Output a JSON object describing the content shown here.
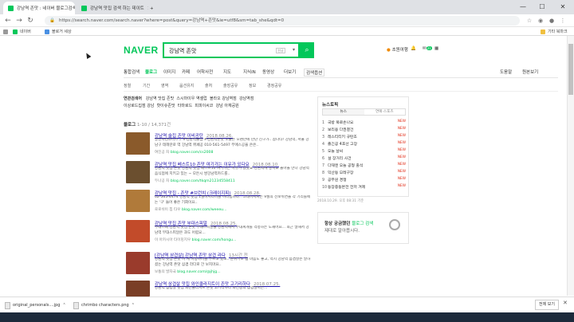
{
  "browser": {
    "tabs": [
      {
        "label": "강남역 존맛 : 네이버 블로그검색",
        "active": true
      },
      {
        "label": "강남역 맛집 검색 하는 데이트",
        "active": false
      }
    ],
    "new_tab": "+",
    "window_buttons": [
      "—",
      "☐",
      "✕"
    ],
    "url": "https://search.naver.com/search.naver?where=post&query=강남역+존맛&ie=utf8&sm=tab_she&qdt=0",
    "bookmarks": [
      "네이버",
      "블로거 세상"
    ],
    "bookmarks_right": "기타 북마크"
  },
  "naver": {
    "logo": "NAVER",
    "query": "강남역 존맛",
    "kbd": "한글",
    "header_right": [
      "초원여행",
      "메일",
      "알림"
    ],
    "mail_count": "31"
  },
  "category_tabs": [
    "통합검색",
    "블로그",
    "이미지",
    "카페",
    "어학사전",
    "지도",
    "지식iN",
    "동영상",
    "더보기",
    "검색옵션"
  ],
  "category_right": [
    "도움말",
    "원본보기"
  ],
  "filter_options": [
    "정렬",
    "기간",
    "영역",
    "옵션유지",
    "출처",
    "출장공유",
    "정보",
    "경정공유"
  ],
  "related": {
    "label": "연관검색어",
    "row1": [
      "강남역 맛집 존맛",
      "스시마이우 역셀럽",
      "볼라오 강남역점",
      "강남역점"
    ],
    "row2": [
      "이상로드집점 강남",
      "핫이슈존맛",
      "타마로드",
      "피피이씨코",
      "강남 아재공원"
    ]
  },
  "blog": {
    "label": "블로그",
    "count": "1-10 / 14,371건"
  },
  "results": [
    {
      "title": "강남역 술집 존맛 이비공탄",
      "date": "2018.08.26.",
      "desc": "알찬하겐조니스 ♪ #경남역술집 #경남역존맛 오늘은 오랜만에 만난 친구가.. 참나타! 강남역, 서울 강남구 테헤란로 역 강남역 뷔페공 010-561-5497 부에스공을 은은..",
      "blogger": "여진공 자",
      "source": "blog.naver.com/cs2008",
      "color": "#8a5a2b"
    },
    {
      "title": "강남역 맛집 베스트10 존맛 여기가는 이유가 있다요",
      "date": "2018.08.10.",
      "desc": "강남역 맛집 존맛 강남역 맛집 베스트10 여기가는 이유가 있었요 강남역에 중학교 돌아올 만나 강남역 음식점에 지키고 있는 ~ 모든시 쌍강남역카드를..",
      "blogger": "두나공 자",
      "source": "blog.naver.com/tkqm21234558411",
      "color": "#6b4f2f"
    },
    {
      "title": "강남역 맛집 - 존맛 #브런치 (크레이지피)",
      "date": "2018.08.28.",
      "desc": "02-565-4474 강남역 맛집 1월이저다나를 이다입니다.. 크레이지피는 9월의 선보쉬면을 각 기리를에는 '구' 들어 좋은 기회이요..",
      "blogger": "로로쉬이 칩 타우",
      "source": "blog.naver.com/weeeu...",
      "color": "#b07a3a"
    },
    {
      "title": "강남역 맛집 존맛 부대스피알",
      "date": "2018.08.25.",
      "desc": "부대스페 강남역 맛집 존맛 부대스피알을 강남역에서 부대찌개를 걱정하는 도재어요... 최근 많해서 강남역 부대스피알은 과도 어렵요...",
      "blogger": "이 아카시아 타이밍지우",
      "source": "blog.naver.com/hongu...",
      "color": "#c24b2a"
    },
    {
      "title": "[강남역 삼겹살] 강남역 존맛 삼겹 라다",
      "date": "13시간 전",
      "desc": "강남역 맛집 존맛 이 게 이동하나를 부르고 있고.. 분위기도 넘 마음도 좋고, 역시 강남역 삼겹살은 말하셨는 강남역 존맛 삼겹 라다로 간 보지마요..",
      "blogger": "보통의 발자국",
      "source": "blog.naver.com/@jhjg...",
      "color": "#9a3b2c"
    },
    {
      "title": "강남역 삼겹살 맛집 와인클라지트이 존맛 고기리하다",
      "date": "2018.07.25.",
      "desc": "강남역 삼겹살 맛집 와인클라지트 존맛 고기리하다 와인동의 삼겹살이는...",
      "blogger": "",
      "source": "",
      "color": "#7a3e26"
    }
  ],
  "news": {
    "heading": "뉴스토픽",
    "tabs": [
      "뉴스",
      "연예·스포츠"
    ],
    "items": [
      {
        "num": "1",
        "text": "국방 북로손나요",
        "new": true
      },
      {
        "num": "2",
        "text": "보리용 다권결건",
        "new": true
      },
      {
        "num": "3",
        "text": "레스티티키 규탄조",
        "new": true
      },
      {
        "num": "4",
        "text": "졸긴공 4호선 고장",
        "new": true
      },
      {
        "num": "5",
        "text": "오늘 날씨",
        "new": true
      },
      {
        "num": "6",
        "text": "설 장거리 사건",
        "new": true
      },
      {
        "num": "7",
        "text": "다재엔 오늘 공형 출석",
        "new": true
      },
      {
        "num": "8",
        "text": "익산동 모레구장",
        "new": true
      },
      {
        "num": "9",
        "text": "공무원 경쟁",
        "new": true
      },
      {
        "num": "10",
        "text": "동장중동본전 전저 겨제",
        "new": true
      }
    ],
    "new_label": "NEW",
    "footer": "2018.10.29. 오후 08:31 기준"
  },
  "ad": {
    "line1_a": "항상 궁금했던 ",
    "line1_b": "블로그 검색",
    "line2": "제대로 알아봅시다."
  },
  "downloads": [
    {
      "name": "original_personals....jpg"
    },
    {
      "name": "chrimbo characters.png"
    }
  ],
  "downloads_all": "전체 보기",
  "colors": {
    "brand": "#03c75a",
    "link": "#1a0dab",
    "new": "#e2321d"
  }
}
